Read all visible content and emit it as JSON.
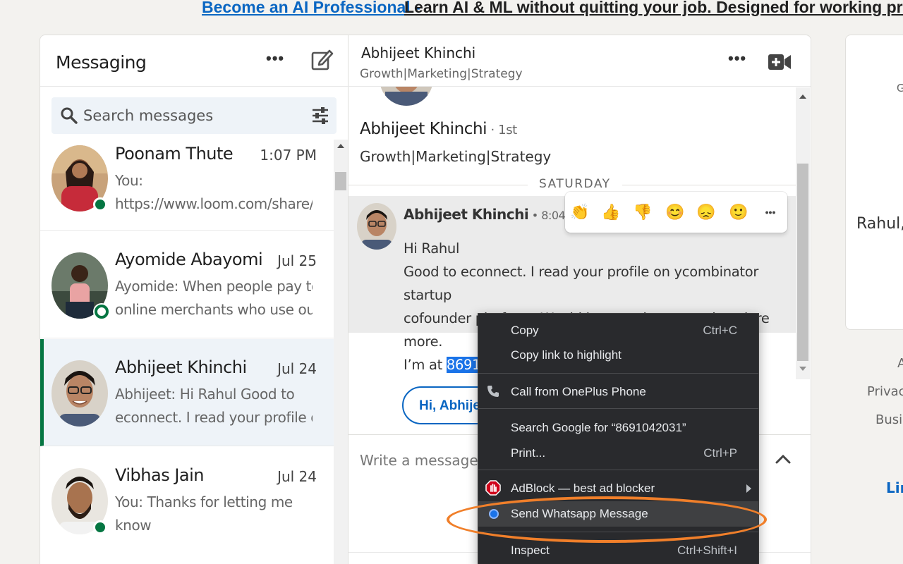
{
  "banner": {
    "link_text": "Become an AI Professional -",
    "text": "Learn AI & ML without quitting your job. Designed for working professionals"
  },
  "messaging": {
    "title": "Messaging",
    "more_label": "•••",
    "search_placeholder": "Search messages",
    "conversations": [
      {
        "name": "Poonam Thute",
        "time": "1:07 PM",
        "preview_line1": "You:",
        "preview_line2": "https://www.loom.com/share/...",
        "status": "online"
      },
      {
        "name": "Ayomide Abayomi",
        "time": "Jul 25",
        "preview_line1": "Ayomide: When people pay to",
        "preview_line2": "online merchants who use our...",
        "status": "mobile"
      },
      {
        "name": "Abhijeet Khinchi",
        "time": "Jul 24",
        "preview_line1": "Abhijeet: Hi Rahul Good to",
        "preview_line2": "econnect. I read your profile o...",
        "status": "none",
        "active": true
      },
      {
        "name": "Vibhas Jain",
        "time": "Jul 24",
        "preview_line1": "You: Thanks for letting me",
        "preview_line2": "know",
        "status": "online"
      }
    ]
  },
  "conversation": {
    "header_name": "Abhijeet Khinchi",
    "header_headline": "Growth|Marketing|Strategy",
    "more_label": "•••",
    "profile_name": "Abhijeet Khinchi",
    "profile_degree": " · 1st",
    "profile_headline": "Growth|Marketing|Strategy",
    "day_label": "SATURDAY",
    "message": {
      "sender": "Abhijeet Khinchi",
      "time": " • 8:04 PM",
      "line1": "Hi Rahul",
      "line2": "Good to econnect. I read your profile on ycombinator startup",
      "line3": "cofounder platform. Would love to chat up and explore more.",
      "line4_prefix": "I’m at ",
      "line4_highlight": "8691042031"
    },
    "reactions": [
      "👏",
      "👍",
      "👎",
      "😊",
      "😞",
      "🙂"
    ],
    "reactions_more": "•••",
    "smart_reply": "Hi, Abhijeet",
    "compose_placeholder": "Write a message..."
  },
  "rail": {
    "g_text": "G",
    "rahul_text": "Rahul, e",
    "foot1": "A",
    "foot2": "Privacy",
    "foot3": "Busin",
    "brand": "Lin"
  },
  "context_menu": {
    "items": [
      {
        "label": "Copy",
        "shortcut": "Ctrl+C"
      },
      {
        "label": "Copy link to highlight",
        "shortcut": ""
      },
      {
        "label": "Call from OnePlus Phone",
        "shortcut": ""
      },
      {
        "label": "Search Google for “8691042031”",
        "shortcut": ""
      },
      {
        "label": "Print...",
        "shortcut": "Ctrl+P"
      },
      {
        "label": "AdBlock — best ad blocker",
        "shortcut": ""
      },
      {
        "label": "Send Whatsapp Message",
        "shortcut": ""
      },
      {
        "label": "Inspect",
        "shortcut": "Ctrl+Shift+I"
      }
    ]
  },
  "colors": {
    "brand_blue": "#0a66c2",
    "online_green": "#057642",
    "annotation_orange": "#f07f2a",
    "menu_bg": "#292a2d"
  }
}
